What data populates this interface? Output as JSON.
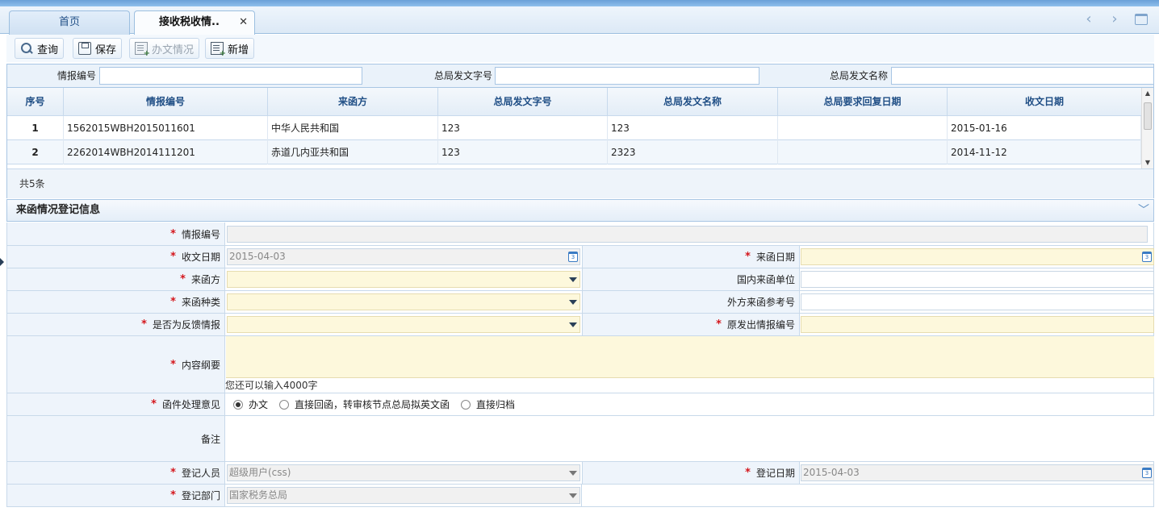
{
  "tabs": [
    {
      "label": "首页"
    },
    {
      "label": "接收税收情..",
      "close": "✕"
    }
  ],
  "toolbar": {
    "query": "查询",
    "save": "保存",
    "status": "办文情况",
    "add": "新增"
  },
  "search": {
    "field1": "情报编号",
    "field2": "总局发文字号",
    "field3": "总局发文名称"
  },
  "grid": {
    "headers": [
      "序号",
      "情报编号",
      "来函方",
      "总局发文字号",
      "总局发文名称",
      "总局要求回复日期",
      "收文日期"
    ],
    "rows": [
      {
        "no": "1",
        "id": "1562015WBH2015011601",
        "from": "中华人民共和国",
        "doc_no": "123",
        "doc_name": "123",
        "reply_date": "",
        "recv_date": "2015-01-16"
      },
      {
        "no": "2",
        "id": "2262014WBH2014111201",
        "from": "赤道几内亚共和国",
        "doc_no": "123",
        "doc_name": "2323",
        "reply_date": "",
        "recv_date": "2014-11-12"
      }
    ],
    "footer": "共5条"
  },
  "panel": {
    "title": "来函情况登记信息"
  },
  "form": {
    "req": "*",
    "intel_no_label": "情报编号",
    "recv_date_label": "收文日期",
    "recv_date_value": "2015-04-03",
    "letter_date_label": "来函日期",
    "sender_label": "来函方",
    "domestic_unit_label": "国内来函单位",
    "letter_type_label": "来函种类",
    "foreign_ref_label": "外方来函参考号",
    "feedback_label": "是否为反馈情报",
    "orig_intel_label": "原发出情报编号",
    "summary_label": "内容纲要",
    "summary_hint": "您还可以输入4000字",
    "opinion_label": "函件处理意见",
    "opinion_options": [
      "办文",
      "直接回函，转审核节点总局拟英文函",
      "直接归档"
    ],
    "remark_label": "备注",
    "registrar_label": "登记人员",
    "registrar_value": "超级用户(css)",
    "reg_date_label": "登记日期",
    "reg_date_value": "2015-04-03",
    "dept_label": "登记部门",
    "dept_value": "国家税务总局",
    "cal_icon_text": "3"
  }
}
